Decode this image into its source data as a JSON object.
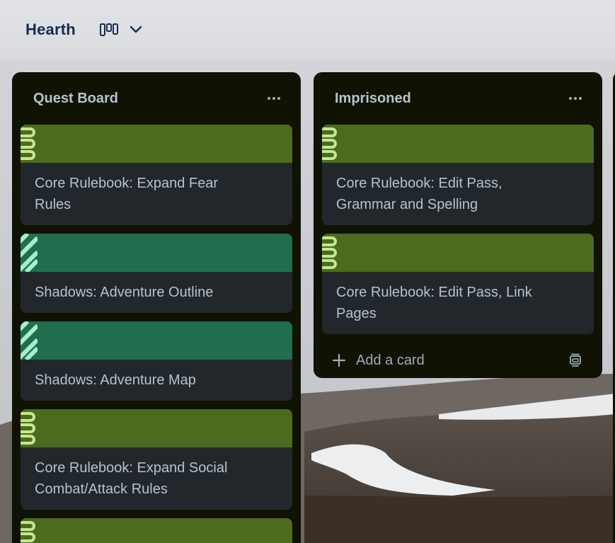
{
  "header": {
    "board_title": "Hearth",
    "view_icon": "board-view-icon",
    "chevron_icon": "chevron-down-icon"
  },
  "colors": {
    "list_bg": "#101204",
    "card_bg": "#22272b",
    "cover_lime": "#4c6b1f",
    "cover_teal": "#216e4e",
    "text": "#b6c2cf"
  },
  "lists": [
    {
      "title": "Quest Board",
      "menu_icon": "more-horizontal-icon",
      "cards": [
        {
          "cover": "lime",
          "pattern": "wave",
          "title": "Core Rulebook: Expand Fear Rules"
        },
        {
          "cover": "teal",
          "pattern": "stripe",
          "title": "Shadows: Adventure Outline"
        },
        {
          "cover": "teal",
          "pattern": "stripe",
          "title": "Shadows: Adventure Map"
        },
        {
          "cover": "lime",
          "pattern": "wave",
          "title": "Core Rulebook: Expand Social Combat/Attack Rules"
        },
        {
          "cover": "lime",
          "pattern": "wave",
          "title": ""
        }
      ]
    },
    {
      "title": "Imprisoned",
      "menu_icon": "more-horizontal-icon",
      "cards": [
        {
          "cover": "lime",
          "pattern": "wave",
          "title": "Core Rulebook: Edit Pass, Grammar and Spelling"
        },
        {
          "cover": "lime",
          "pattern": "wave",
          "title": "Core Rulebook: Edit Pass, Link Pages"
        }
      ],
      "add_card_label": "Add a card",
      "add_icon": "plus-icon",
      "template_icon": "card-template-icon"
    }
  ]
}
